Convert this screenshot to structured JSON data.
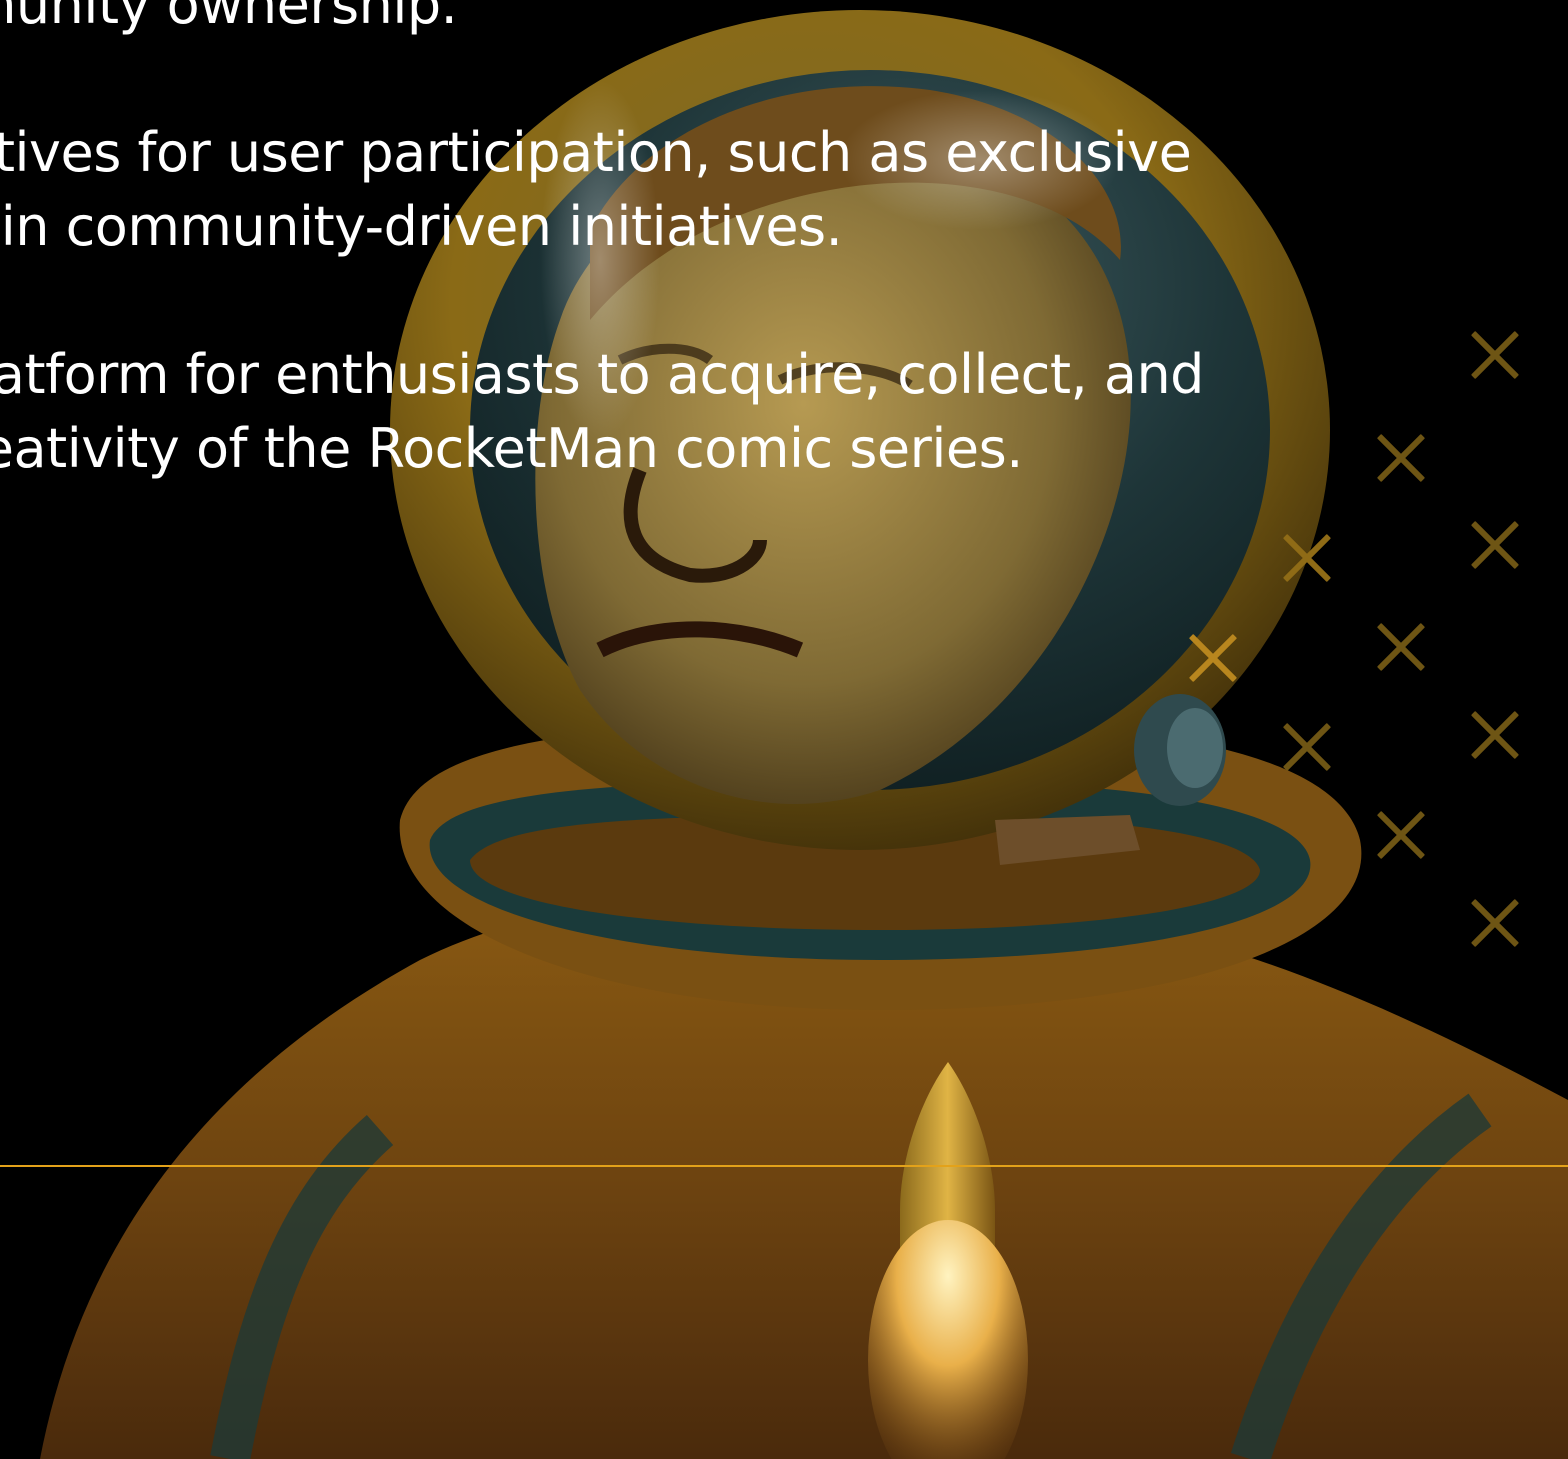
{
  "content": {
    "line_1": "community ownership.",
    "line_2": "incentives for user participation, such as exclusive",
    "line_3": "ation in community-driven initiatives.",
    "line_4": "s a platform for enthusiasts to acquire, collect, and",
    "line_5": "tic creativity of the RocketMan comic series."
  },
  "colors": {
    "background": "#000000",
    "text": "#ffffff",
    "accent": "#e3a21a",
    "x_mark_dim": "#6e5514",
    "x_mark_bright": "#b8861e"
  },
  "decorations": {
    "illustration": "astronaut-in-golden-helmet-illustration",
    "pattern_icon": "x-icon"
  }
}
